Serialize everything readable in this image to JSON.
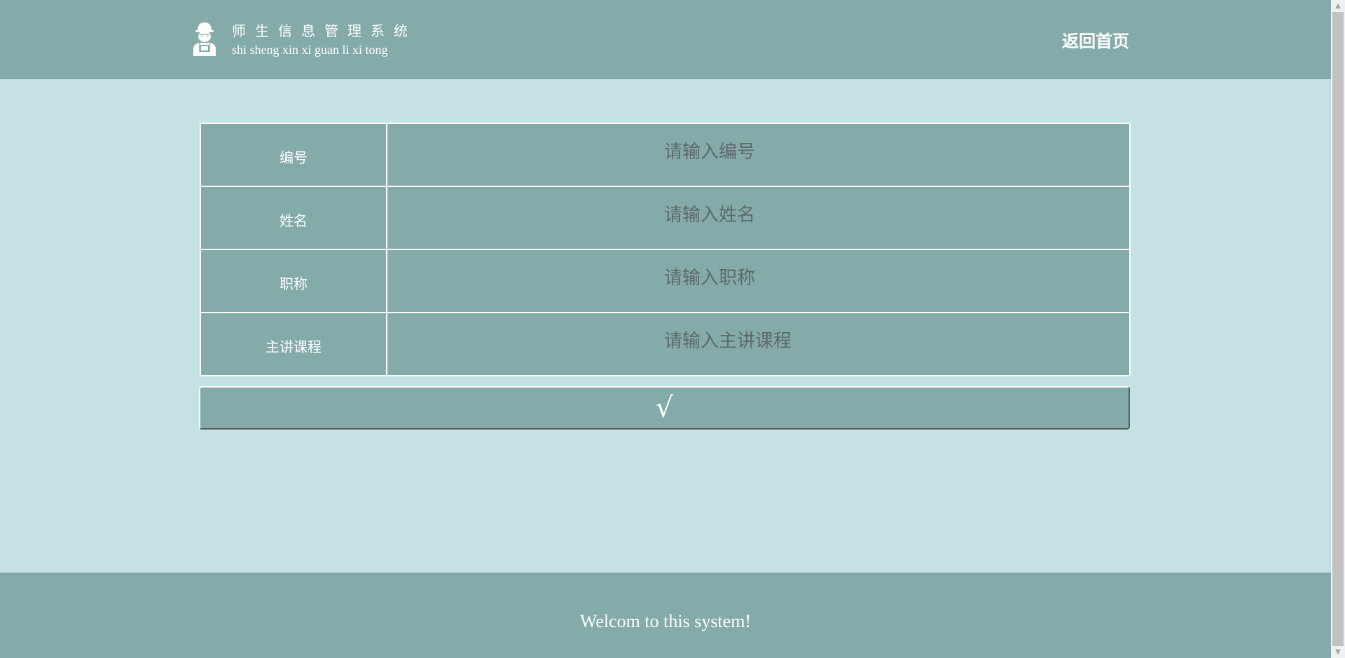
{
  "header": {
    "title_cn": "师生信息管理系统",
    "title_en": "shi sheng xin xi guan li xi tong",
    "home_link": "返回首页",
    "logo_icon": "user-worker-icon"
  },
  "form": {
    "fields": [
      {
        "label": "编号",
        "placeholder": "请输入编号",
        "value": ""
      },
      {
        "label": "姓名",
        "placeholder": "请输入姓名",
        "value": ""
      },
      {
        "label": "职称",
        "placeholder": "请输入职称",
        "value": ""
      },
      {
        "label": "主讲课程",
        "placeholder": "请输入主讲课程",
        "value": ""
      }
    ],
    "submit_label": "√"
  },
  "footer": {
    "text": "Welcom to this system!"
  },
  "colors": {
    "primary": "#84aaaa",
    "background": "#c4e2e4",
    "text": "#ffffff"
  }
}
